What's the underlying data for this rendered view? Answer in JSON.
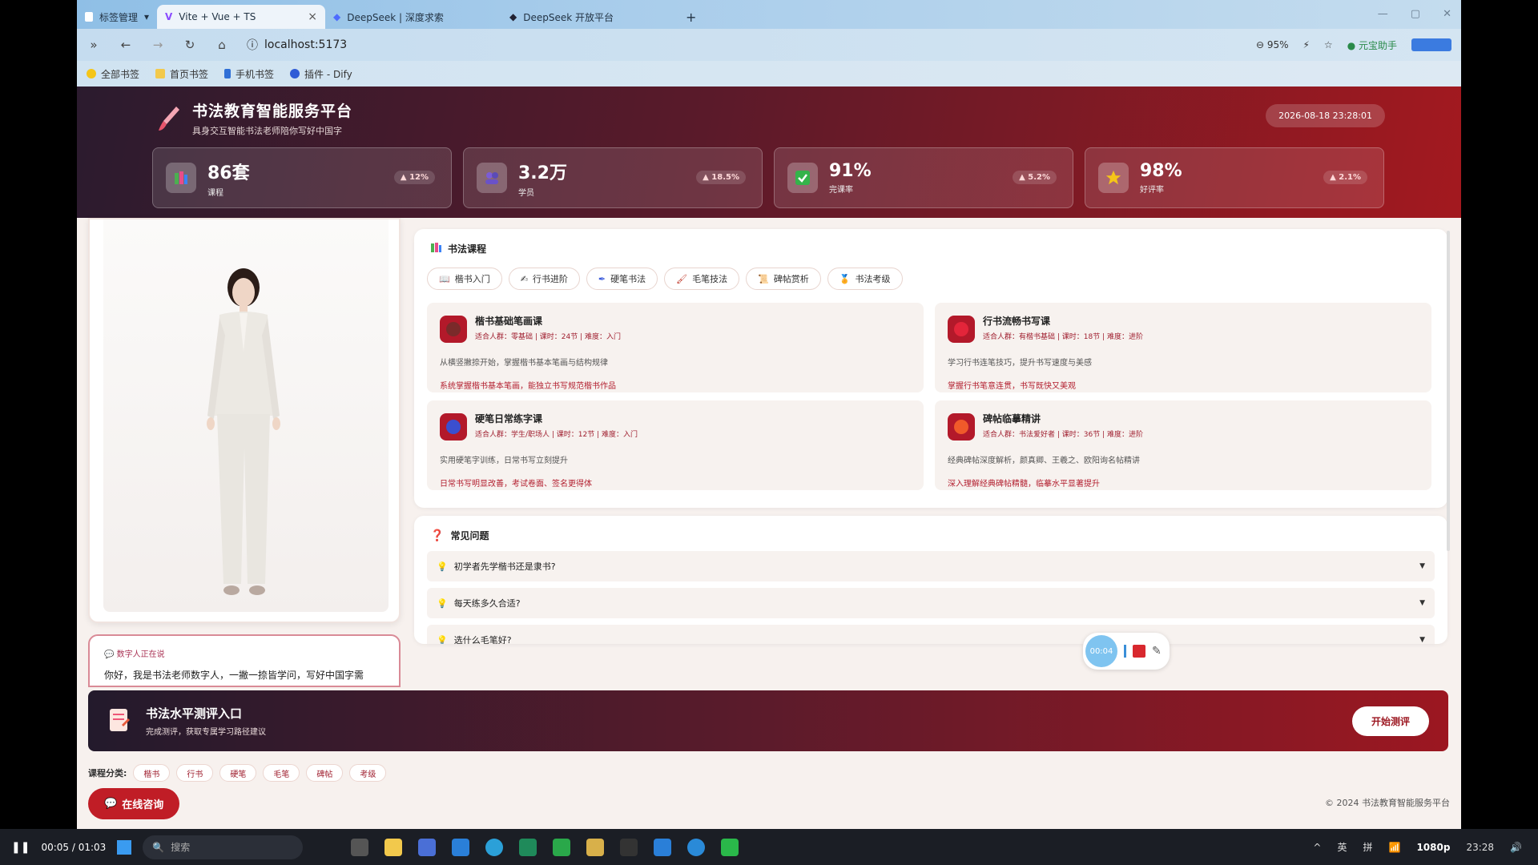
{
  "browser": {
    "tabs": [
      {
        "label": "标签管理"
      },
      {
        "label": "Vite + Vue + TS",
        "active": true
      },
      {
        "label": "DeepSeek | 深度求索"
      },
      {
        "label": "DeepSeek 开放平台"
      }
    ],
    "new_tab": "+",
    "url": "localhost:5173",
    "zoom": "95%",
    "assistant": "元宝助手",
    "bookmarks": [
      "全部书签",
      "首页书签",
      "手机书签",
      "插件 - Dify"
    ]
  },
  "header": {
    "title": "书法教育智能服务平台",
    "subtitle": "具身交互智能书法老师陪你写好中国字",
    "datetime": "2026-08-18 23:28:01"
  },
  "stats": [
    {
      "value": "86套",
      "label": "课程",
      "trend": "▲ 12%",
      "icon": "books-icon"
    },
    {
      "value": "3.2万",
      "label": "学员",
      "trend": "▲ 18.5%",
      "icon": "users-icon"
    },
    {
      "value": "91%",
      "label": "完课率",
      "trend": "▲ 5.2%",
      "icon": "check-icon"
    },
    {
      "value": "98%",
      "label": "好评率",
      "trend": "▲ 2.1%",
      "icon": "star-icon"
    }
  ],
  "avatar": {
    "status_label": "数字人正在说",
    "speech": "你好，我是书法老师数字人，一撇一捺皆学问，写好中国字需"
  },
  "courses": {
    "title": "书法课程",
    "categories": [
      "楷书入门",
      "行书进阶",
      "硬笔书法",
      "毛笔技法",
      "碑帖赏析",
      "书法考级"
    ],
    "items": [
      {
        "title": "楷书基础笔画课",
        "meta": "适合人群：零基础 | 课时：24节 | 难度：入门",
        "desc": "从横竖撇捺开始，掌握楷书基本笔画与结构规律",
        "goal": "系统掌握楷书基本笔画，能独立书写规范楷书作品",
        "color": "#7a2a2a"
      },
      {
        "title": "行书流畅书写课",
        "meta": "适合人群：有楷书基础 | 课时：18节 | 难度：进阶",
        "desc": "学习行书连笔技巧，提升书写速度与美感",
        "goal": "掌握行书笔意连贯，书写既快又美观",
        "color": "#e3253a"
      },
      {
        "title": "硬笔日常练字课",
        "meta": "适合人群：学生/职场人 | 课时：12节 | 难度：入门",
        "desc": "实用硬笔字训练，日常书写立刻提升",
        "goal": "日常书写明显改善，考试卷面、签名更得体",
        "color": "#3b4fcf"
      },
      {
        "title": "碑帖临摹精讲",
        "meta": "适合人群：书法爱好者 | 课时：36节 | 难度：进阶",
        "desc": "经典碑帖深度解析，颜真卿、王羲之、欧阳询名帖精讲",
        "goal": "深入理解经典碑帖精髓，临摹水平显著提升",
        "color": "#f05a2a"
      }
    ]
  },
  "faq": {
    "title": "常见问题",
    "items": [
      "初学者先学楷书还是隶书?",
      "每天练多久合适?",
      "选什么毛笔好?"
    ]
  },
  "recorder": {
    "time": "00:04"
  },
  "assessment": {
    "title": "书法水平测评入口",
    "subtitle": "完成测评，获取专属学习路径建议",
    "button": "开始测评"
  },
  "tags": {
    "label": "课程分类:",
    "items": [
      "楷书",
      "行书",
      "硬笔",
      "毛笔",
      "碑帖",
      "考级"
    ]
  },
  "consult": "在线咨询",
  "copyright": "© 2024 书法教育智能服务平台",
  "taskbar": {
    "time_played": "00:05 / 01:03",
    "search": "搜索",
    "ime1": "英",
    "ime2": "拼",
    "quality": "1080p",
    "clock": "23:28"
  },
  "colors": {
    "brand_red": "#a3191f",
    "dark": "#2b1b2e"
  }
}
